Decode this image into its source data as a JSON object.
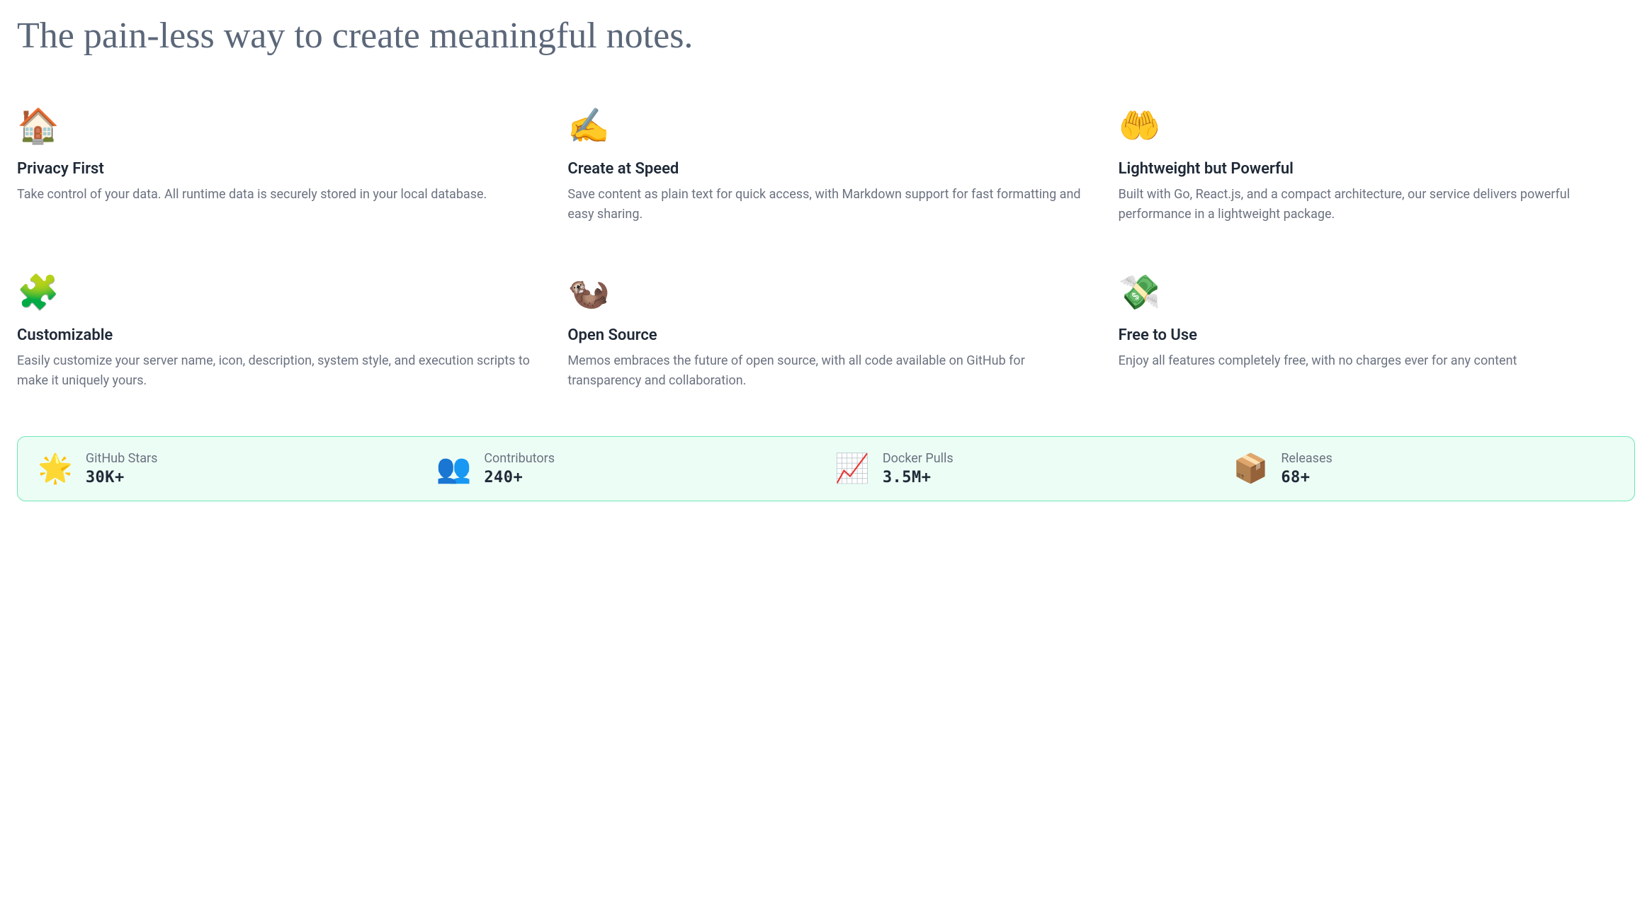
{
  "heading": "The pain-less way to create meaningful notes.",
  "features": [
    {
      "icon": "🏠",
      "title": "Privacy First",
      "desc": "Take control of your data. All runtime data is securely stored in your local database."
    },
    {
      "icon": "✍️",
      "title": "Create at Speed",
      "desc": "Save content as plain text for quick access, with Markdown support for fast formatting and easy sharing."
    },
    {
      "icon": "🤲",
      "title": "Lightweight but Powerful",
      "desc": "Built with Go, React.js, and a compact architecture, our service delivers powerful performance in a lightweight package."
    },
    {
      "icon": "🧩",
      "title": "Customizable",
      "desc": "Easily customize your server name, icon, description, system style, and execution scripts to make it uniquely yours."
    },
    {
      "icon": "🦦",
      "title": "Open Source",
      "desc": "Memos embraces the future of open source, with all code available on GitHub for transparency and collaboration."
    },
    {
      "icon": "💸",
      "title": "Free to Use",
      "desc": "Enjoy all features completely free, with no charges ever for any content"
    }
  ],
  "stats": [
    {
      "icon": "🌟",
      "label": "GitHub Stars",
      "value": "30K+"
    },
    {
      "icon": "👥",
      "label": "Contributors",
      "value": "240+"
    },
    {
      "icon": "📈",
      "label": "Docker Pulls",
      "value": "3.5M+"
    },
    {
      "icon": "📦",
      "label": "Releases",
      "value": "68+"
    }
  ]
}
